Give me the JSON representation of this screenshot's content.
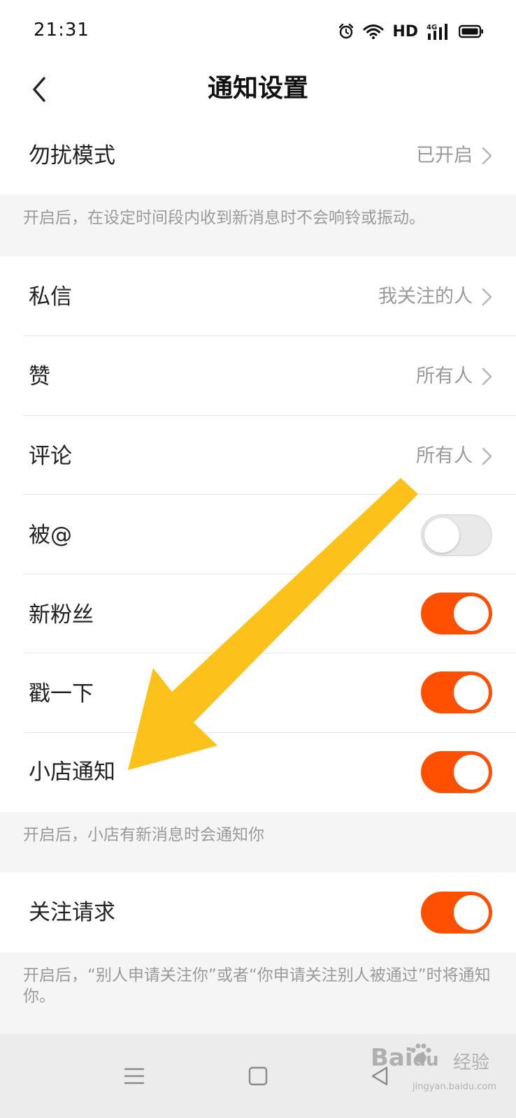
{
  "status_bar": {
    "time": "21:31",
    "hd_label": "HD",
    "network_label": "4G",
    "icons": [
      "alarm-icon",
      "wifi-icon",
      "signal-icon",
      "battery-icon"
    ]
  },
  "header": {
    "title": "通知设置",
    "back_icon": "chevron-left-icon"
  },
  "dnd": {
    "label": "勿扰模式",
    "value": "已开启",
    "note": "开启后，在设定时间段内收到新消息时不会响铃或振动。"
  },
  "settings": {
    "dm": {
      "label": "私信",
      "value": "我关注的人"
    },
    "likes": {
      "label": "赞",
      "value": "所有人"
    },
    "comments": {
      "label": "评论",
      "value": "所有人"
    },
    "mentions": {
      "label": "被@",
      "enabled": false
    },
    "new_followers": {
      "label": "新粉丝",
      "enabled": true
    },
    "poke": {
      "label": "戳一下",
      "enabled": true
    },
    "shop": {
      "label": "小店通知",
      "enabled": true,
      "note": "开启后，小店有新消息时会通知你"
    }
  },
  "follow_request": {
    "label": "关注请求",
    "enabled": true,
    "note": "开启后，“别人申请关注你”或者“你申请关注别人被通过”时将通知你。"
  },
  "system_nav": {
    "icons": [
      "menu-icon",
      "home-square-icon",
      "back-triangle-icon"
    ]
  },
  "watermark": {
    "brand": "Bai",
    "brand_tail": "du",
    "product": "经验",
    "url": "jingyan.baidu.com"
  },
  "colors": {
    "accent": "#fe5000",
    "arrow": "#fcc21b",
    "toggle_off": "#e9e9e9",
    "page_bg": "#f5f5f5"
  }
}
